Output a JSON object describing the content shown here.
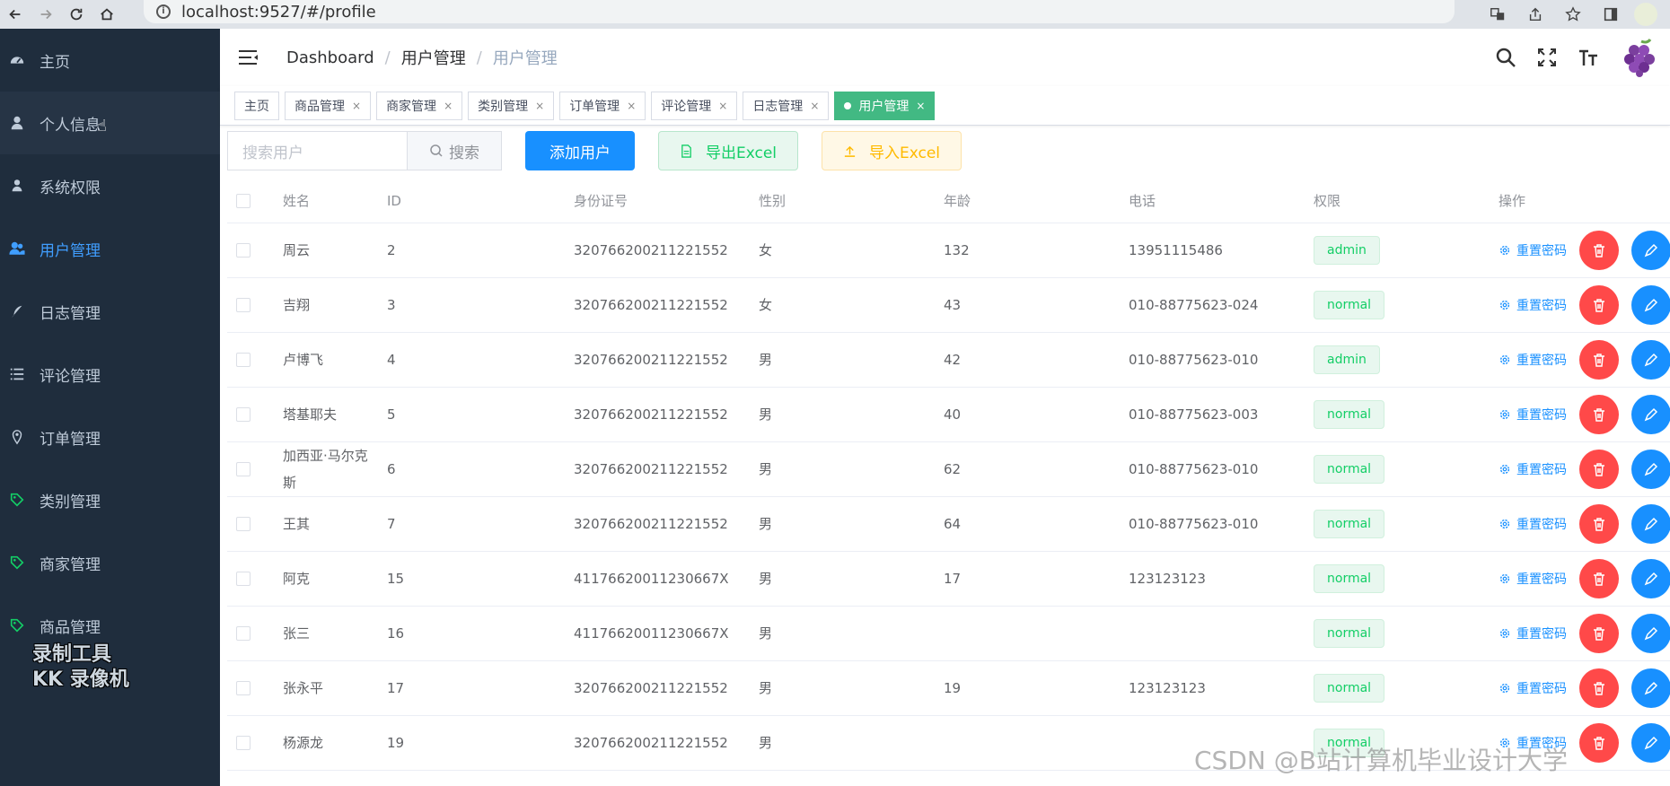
{
  "browser": {
    "url": "localhost:9527/#/profile"
  },
  "sidebar": {
    "items": [
      {
        "label": "主页",
        "icon": "dashboard-icon"
      },
      {
        "label": "个人信息",
        "icon": "user-icon"
      },
      {
        "label": "系统权限",
        "icon": "user-lock-icon"
      },
      {
        "label": "用户管理",
        "icon": "peoples-icon"
      },
      {
        "label": "日志管理",
        "icon": "feather-icon"
      },
      {
        "label": "评论管理",
        "icon": "list-icon"
      },
      {
        "label": "订单管理",
        "icon": "location-icon"
      },
      {
        "label": "类别管理",
        "icon": "tag-icon"
      },
      {
        "label": "商家管理",
        "icon": "tag-icon"
      },
      {
        "label": "商品管理",
        "icon": "tag-icon"
      }
    ],
    "watermark_line1": "录制工具",
    "watermark_line2": "KK 录像机"
  },
  "navbar": {
    "breadcrumb": [
      "Dashboard",
      "用户管理",
      "用户管理"
    ]
  },
  "tags": [
    {
      "label": "主页",
      "closable": false
    },
    {
      "label": "商品管理",
      "closable": true
    },
    {
      "label": "商家管理",
      "closable": true
    },
    {
      "label": "类别管理",
      "closable": true
    },
    {
      "label": "订单管理",
      "closable": true
    },
    {
      "label": "评论管理",
      "closable": true
    },
    {
      "label": "日志管理",
      "closable": true
    },
    {
      "label": "用户管理",
      "closable": true,
      "active": true
    }
  ],
  "toolbar": {
    "search_placeholder": "搜索用户",
    "search_label": "搜索",
    "add_label": "添加用户",
    "export_label": "导出Excel",
    "import_label": "导入Excel"
  },
  "table": {
    "headers": [
      "姓名",
      "ID",
      "身份证号",
      "性别",
      "年龄",
      "电话",
      "权限",
      "操作"
    ],
    "reset_label": "重置密码",
    "rows": [
      {
        "name": "周云",
        "id": "2",
        "idcard": "320766200211221552",
        "gender": "女",
        "age": "132",
        "phone": "13951115486",
        "role": "admin"
      },
      {
        "name": "吉翔",
        "id": "3",
        "idcard": "320766200211221552",
        "gender": "女",
        "age": "43",
        "phone": "010-88775623-024",
        "role": "normal"
      },
      {
        "name": "卢博飞",
        "id": "4",
        "idcard": "320766200211221552",
        "gender": "男",
        "age": "42",
        "phone": "010-88775623-010",
        "role": "admin"
      },
      {
        "name": "塔基耶夫",
        "id": "5",
        "idcard": "320766200211221552",
        "gender": "男",
        "age": "40",
        "phone": "010-88775623-003",
        "role": "normal"
      },
      {
        "name": "加西亚·马尔克斯",
        "id": "6",
        "idcard": "320766200211221552",
        "gender": "男",
        "age": "62",
        "phone": "010-88775623-010",
        "role": "normal"
      },
      {
        "name": "王其",
        "id": "7",
        "idcard": "320766200211221552",
        "gender": "男",
        "age": "64",
        "phone": "010-88775623-010",
        "role": "normal"
      },
      {
        "name": "阿克",
        "id": "15",
        "idcard": "41176620011230667X",
        "gender": "男",
        "age": "17",
        "phone": "123123123",
        "role": "normal"
      },
      {
        "name": "张三",
        "id": "16",
        "idcard": "41176620011230667X",
        "gender": "男",
        "age": "",
        "phone": "",
        "role": "normal"
      },
      {
        "name": "张永平",
        "id": "17",
        "idcard": "320766200211221552",
        "gender": "男",
        "age": "19",
        "phone": "123123123",
        "role": "normal"
      },
      {
        "name": "杨源龙",
        "id": "19",
        "idcard": "320766200211221552",
        "gender": "男",
        "age": "",
        "phone": "",
        "role": "normal"
      }
    ]
  },
  "watermark": "CSDN @B站计算机毕业设计大学"
}
